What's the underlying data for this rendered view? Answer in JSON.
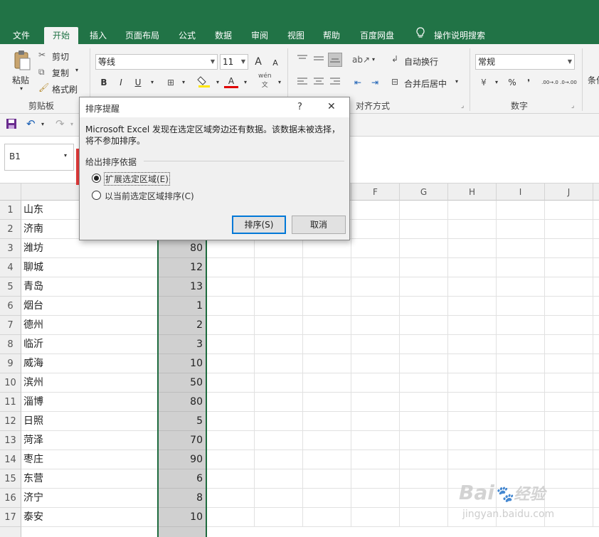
{
  "tabs": [
    {
      "label": "文件"
    },
    {
      "label": "开始"
    },
    {
      "label": "插入"
    },
    {
      "label": "页面布局"
    },
    {
      "label": "公式"
    },
    {
      "label": "数据"
    },
    {
      "label": "审阅"
    },
    {
      "label": "视图"
    },
    {
      "label": "帮助"
    },
    {
      "label": "百度网盘"
    },
    {
      "label": "操作说明搜索"
    }
  ],
  "ribbon": {
    "clipboard": {
      "paste": "粘贴",
      "cut": "剪切",
      "copy": "复制",
      "format_painter": "格式刷",
      "group": "剪贴板"
    },
    "font": {
      "name": "等线",
      "size": "11",
      "bold": "B",
      "italic": "I",
      "underline": "U",
      "grow": "A",
      "shrink": "A",
      "color_letter": "A",
      "phonetic_top": "wén",
      "phonetic_bottom": "文"
    },
    "alignment": {
      "wrap": "自动换行",
      "merge": "合并后居中",
      "group": "对齐方式"
    },
    "number": {
      "format": "常规",
      "percent": "%",
      "group": "数字",
      "inc": ".00→.0",
      "dec": ".0→.00"
    },
    "cond": "条件"
  },
  "namebox": "B1",
  "columns": [
    "F",
    "G",
    "H",
    "I",
    "J"
  ],
  "rows": [
    {
      "num": "1",
      "city": "山东",
      "value": ""
    },
    {
      "num": "2",
      "city": "济南",
      "value": ""
    },
    {
      "num": "3",
      "city": "潍坊",
      "value": "80"
    },
    {
      "num": "4",
      "city": "聊城",
      "value": "12"
    },
    {
      "num": "5",
      "city": "青岛",
      "value": "13"
    },
    {
      "num": "6",
      "city": "烟台",
      "value": "1"
    },
    {
      "num": "7",
      "city": "德州",
      "value": "2"
    },
    {
      "num": "8",
      "city": "临沂",
      "value": "3"
    },
    {
      "num": "9",
      "city": "威海",
      "value": "10"
    },
    {
      "num": "10",
      "city": "滨州",
      "value": "50"
    },
    {
      "num": "11",
      "city": "淄博",
      "value": "80"
    },
    {
      "num": "12",
      "city": "日照",
      "value": "5"
    },
    {
      "num": "13",
      "city": "菏泽",
      "value": "70"
    },
    {
      "num": "14",
      "city": "枣庄",
      "value": "90"
    },
    {
      "num": "15",
      "city": "东营",
      "value": "6"
    },
    {
      "num": "16",
      "city": "济宁",
      "value": "8"
    },
    {
      "num": "17",
      "city": "泰安",
      "value": "10"
    }
  ],
  "dialog": {
    "title": "排序提醒",
    "help": "?",
    "close": "✕",
    "message": "Microsoft Excel 发现在选定区域旁边还有数据。该数据未被选择，将不参加排序。",
    "section": "给出排序依据",
    "option1": "扩展选定区域(E)",
    "option2": "以当前选定区域排序(C)",
    "sort": "排序(S)",
    "cancel": "取消"
  },
  "watermark": {
    "brand": "Bai",
    "brand_cn": "经验",
    "url": "jingyan.baidu.com"
  },
  "colors": {
    "excel_green": "#217346",
    "annotation_red": "#e23b3b",
    "selection_gray": "#d0d0d0",
    "focus_blue": "#0078d7"
  }
}
